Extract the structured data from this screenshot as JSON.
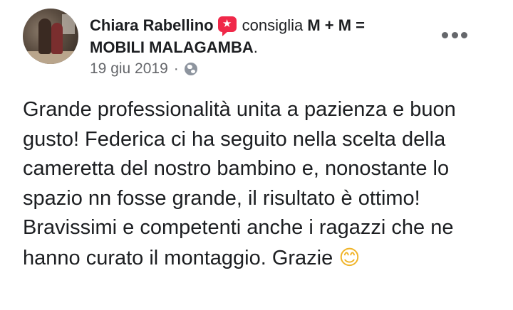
{
  "post": {
    "author": "Chiara Rabellino",
    "action": "consiglia",
    "page_name_line1": "M + M =",
    "page_name_line2": "MOBILI MALAGAMBA",
    "date": "19 giu 2019",
    "separator": "·",
    "privacy_icon": "globe-icon",
    "recommend_icon": "recommend-star-icon",
    "badge_color": "#f02849",
    "text": "Grande professionalità unita a pazienza e buon gusto! Federica ci ha seguito nella scelta della cameretta del nostro bambino e, nonostante lo spazio nn fosse grande, il risultato è ottimo! Bravissimi e competenti anche i ragazzi che ne hanno curato il montaggio. Grazie",
    "emoji": "😊"
  }
}
